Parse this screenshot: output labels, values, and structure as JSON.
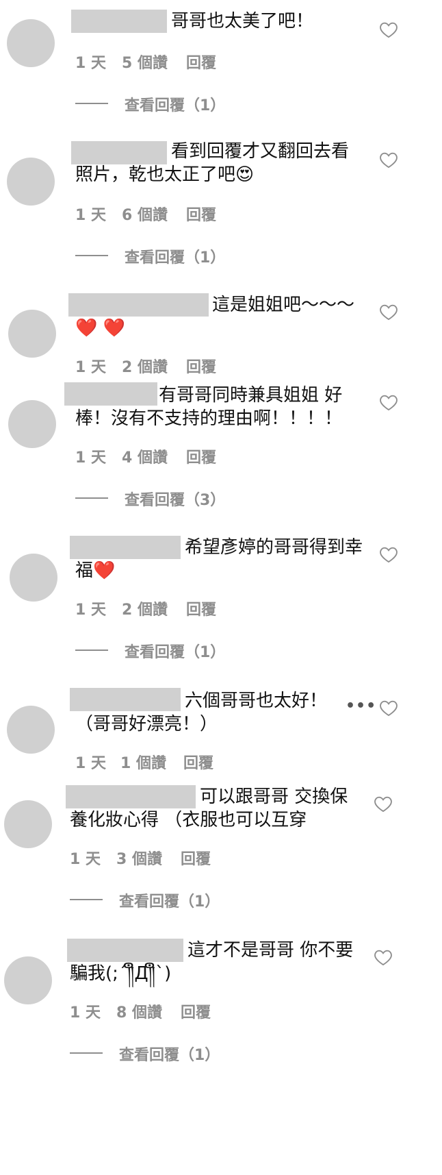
{
  "comments": [
    {
      "text1": "哥哥也太美了吧！",
      "text2": "",
      "time": "1 天",
      "likes": "5 個讚",
      "reply": "回覆",
      "view_replies": "查看回覆（1）"
    },
    {
      "text1": "看到回覆才又翻回去看",
      "text2": "照片，乾也太正了吧😍",
      "time": "1 天",
      "likes": "6 個讚",
      "reply": "回覆",
      "view_replies": "查看回覆（1）"
    },
    {
      "text1": "這是姐姐吧～～～",
      "text2": "❤️ ❤️",
      "time": "1 天",
      "likes": "2 個讚",
      "reply": "回覆",
      "view_replies": ""
    },
    {
      "text1": "有哥哥同時兼具姐姐 好",
      "text2": "棒！沒有不支持的理由啊！！！！",
      "time": "1 天",
      "likes": "4 個讚",
      "reply": "回覆",
      "view_replies": "查看回覆（3）"
    },
    {
      "text1": "希望彥婷的哥哥得到幸",
      "text2": "福❤️",
      "time": "1 天",
      "likes": "2 個讚",
      "reply": "回覆",
      "view_replies": "查看回覆（1）"
    },
    {
      "text1": "六個哥哥也太好！",
      "text2": "（哥哥好漂亮！）",
      "time": "1 天",
      "likes": "1 個讚",
      "reply": "回覆",
      "view_replies": ""
    },
    {
      "text1": "可以跟哥哥 交換保",
      "text2": "養化妝心得 （衣服也可以互穿",
      "time": "1 天",
      "likes": "3 個讚",
      "reply": "回覆",
      "view_replies": "查看回覆（1）"
    },
    {
      "text1": "這才不是哥哥 你不要",
      "text2": "騙我(;´༎ຶД༎ຶ`)",
      "time": "1 天",
      "likes": "8 個讚",
      "reply": "回覆",
      "view_replies": "查看回覆（1）"
    }
  ],
  "more_label": "•••",
  "icons": {
    "like": "heart-outline-icon",
    "more": "more-icon"
  }
}
